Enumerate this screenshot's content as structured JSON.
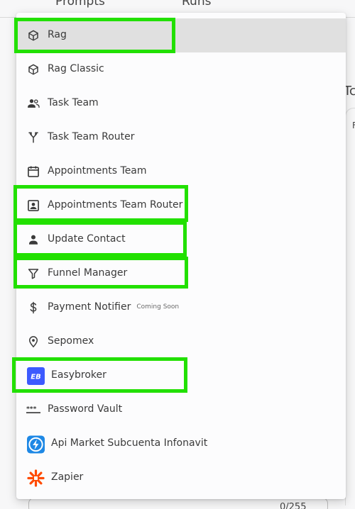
{
  "background": {
    "tabs": [
      "Prompts",
      "Runs"
    ],
    "right_text_1": "Tc",
    "right_text_2": "F",
    "counter": "0/255"
  },
  "menu": {
    "items": [
      {
        "label": "Rag",
        "icon": "cube-outline-icon"
      },
      {
        "label": "Rag Classic",
        "icon": "cube-outline-icon"
      },
      {
        "label": "Task Team",
        "icon": "people-icon"
      },
      {
        "label": "Task Team Router",
        "icon": "fork-icon"
      },
      {
        "label": "Appointments Team",
        "icon": "calendar-icon"
      },
      {
        "label": "Appointments Team Router",
        "icon": "contact-badge-icon"
      },
      {
        "label": "Update Contact",
        "icon": "person-icon"
      },
      {
        "label": "Funnel Manager",
        "icon": "funnel-icon"
      },
      {
        "label": "Payment Notifier",
        "icon": "dollar-icon",
        "badge": "Coming Soon"
      },
      {
        "label": "Sepomex",
        "icon": "location-pin-icon"
      },
      {
        "label": "Easybroker",
        "icon": "easybroker-logo-icon"
      },
      {
        "label": "Password Vault",
        "icon": "password-dots-icon"
      },
      {
        "label": "Api Market Subcuenta Infonavit",
        "icon": "lightning-logo-icon"
      },
      {
        "label": "Zapier",
        "icon": "zapier-logo-icon"
      }
    ],
    "selected": "Rag"
  },
  "colors": {
    "highlight": "#22e000",
    "selected_bg": "#e0e0e0",
    "easybroker_blue": "#3d5afe",
    "lightning_blue": "#1e88e5",
    "zapier_orange": "#ff4a00"
  }
}
